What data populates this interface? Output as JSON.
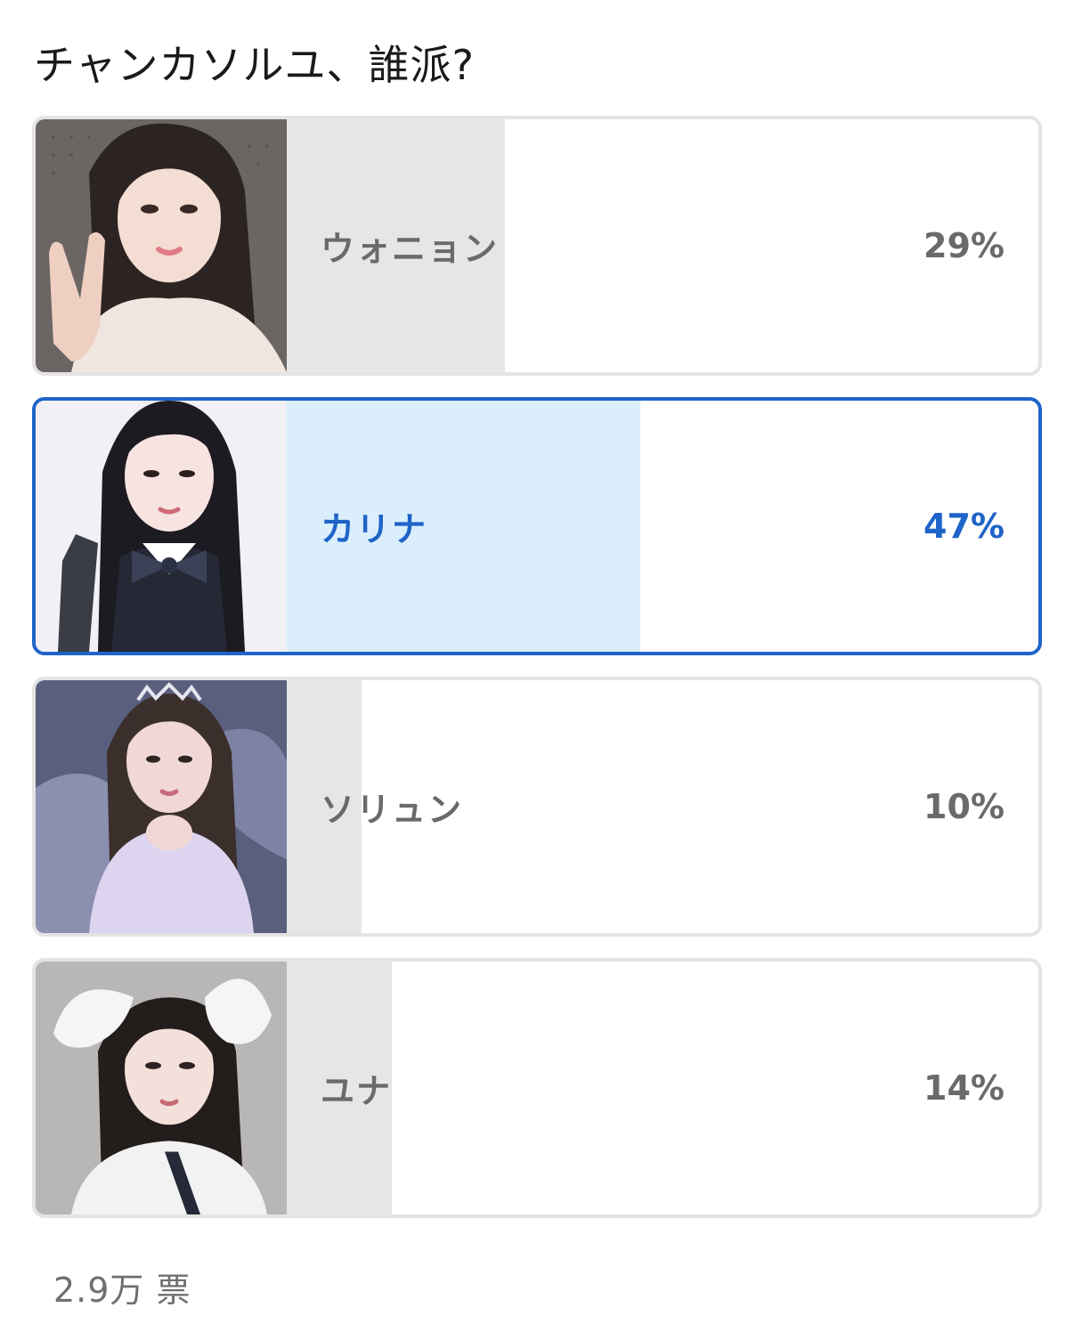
{
  "poll": {
    "title": "チャンカソルユ、誰派?",
    "total_votes": "2.9万 票",
    "options": [
      {
        "name": "ウォニョン",
        "percent_label": "29%",
        "percent": 29,
        "bar_fraction": 0.29,
        "selected": false,
        "photo": "portrait-wonyoung"
      },
      {
        "name": "カリナ",
        "percent_label": "47%",
        "percent": 47,
        "bar_fraction": 0.47,
        "selected": true,
        "photo": "portrait-karina"
      },
      {
        "name": "ソリュン",
        "percent_label": "10%",
        "percent": 10,
        "bar_fraction": 0.1,
        "selected": false,
        "photo": "portrait-sullyoon"
      },
      {
        "name": "ユナ",
        "percent_label": "14%",
        "percent": 14,
        "bar_fraction": 0.14,
        "selected": false,
        "photo": "portrait-yuna"
      }
    ]
  },
  "colors": {
    "accent": "#1f64c8",
    "selected_fill": "#daeefc",
    "default_fill": "#e6e6e6",
    "border": "#e4e4e4",
    "text_muted": "#6a6a6a"
  }
}
